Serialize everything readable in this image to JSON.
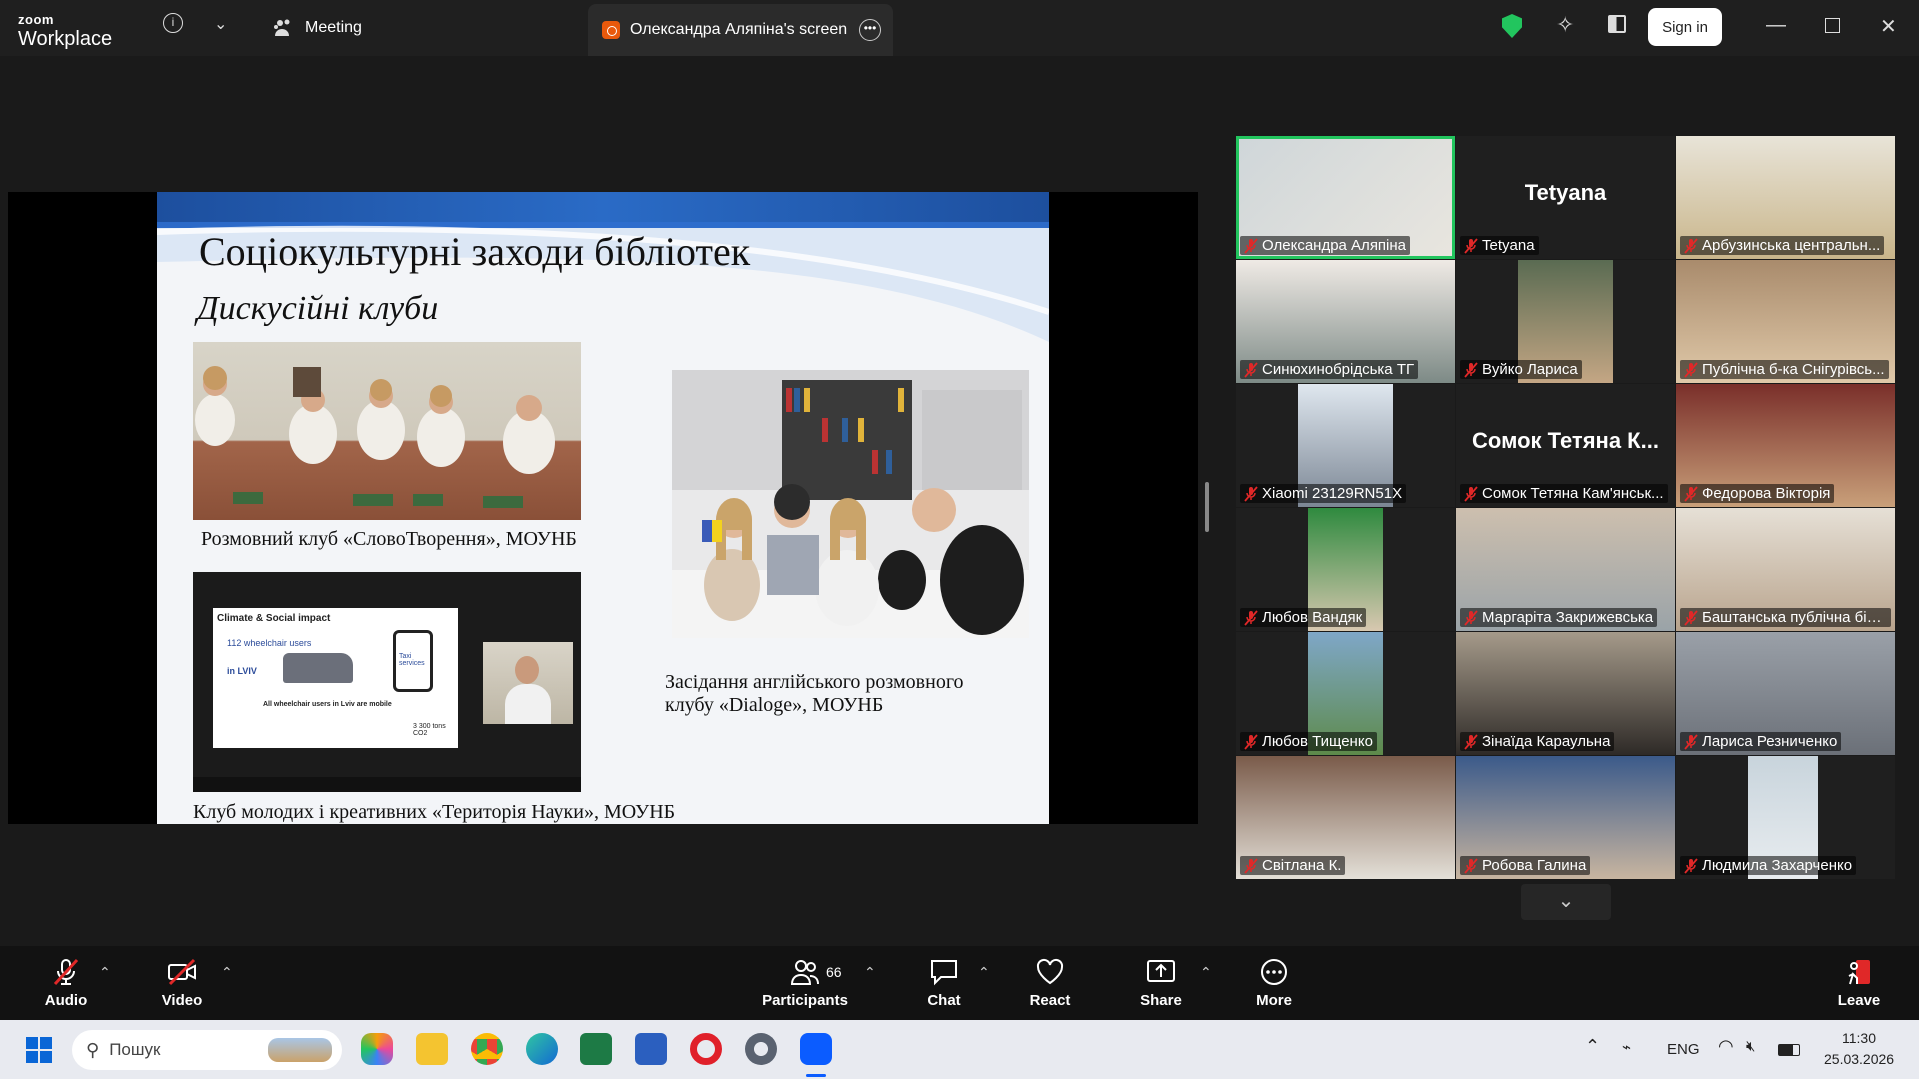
{
  "topbar": {
    "logo_small": "zoom",
    "logo_big": "Workplace",
    "meeting_label": "Meeting",
    "share_tab_label": "Олександра Аляпіна's screen",
    "signin_label": "Sign in"
  },
  "slide": {
    "title": "Соціокультурні заходи бібліотек",
    "subtitle": "Дискусійні клуби",
    "caption1": "Розмовний клуб «СловоТворення», МОУНБ",
    "caption2_line1": "Засідання англійського розмовного",
    "caption2_line2": "клубу «Dialoge», МОУНБ",
    "caption3": "Клуб молодих і креативних «Територія Науки», МОУНБ",
    "inner_slide_title": "Climate & Social impact",
    "inner_text1": "112 wheelchair users",
    "inner_text2": "in LVIV",
    "inner_text3": "All wheelchair users in Lviv are mobile",
    "inner_text4": "Taxi services",
    "inner_text5": "3 300 tons CO2"
  },
  "participants": [
    {
      "name": "Олександра Аляпіна",
      "big": ""
    },
    {
      "name": "Tetyana",
      "big": "Tetyana"
    },
    {
      "name": "Арбузинська центральн...",
      "big": ""
    },
    {
      "name": "Синюхинобрідська ТГ",
      "big": ""
    },
    {
      "name": "Вуйко Лариса",
      "big": ""
    },
    {
      "name": "Публічна б-ка Снігурівсь...",
      "big": ""
    },
    {
      "name": "Xiaomi 23129RN51X",
      "big": ""
    },
    {
      "name": "Сомок Тетяна Кам'янськ...",
      "big": "Сомок Тетяна К..."
    },
    {
      "name": "Федорова Вікторія",
      "big": ""
    },
    {
      "name": "Любов Вандяк",
      "big": ""
    },
    {
      "name": "Маргаріта Закрижевська",
      "big": ""
    },
    {
      "name": "Баштанська публічна біб...",
      "big": ""
    },
    {
      "name": "Любов Тищенко",
      "big": ""
    },
    {
      "name": "Зінаїда Караульна",
      "big": ""
    },
    {
      "name": "Лариса Резниченко",
      "big": ""
    },
    {
      "name": "Світлана К.",
      "big": ""
    },
    {
      "name": "Робова Галина",
      "big": ""
    },
    {
      "name": "Людмила Захарченко",
      "big": ""
    }
  ],
  "toolbar": {
    "audio": "Audio",
    "video": "Video",
    "participants": "Participants",
    "participants_count": "66",
    "chat": "Chat",
    "react": "React",
    "share": "Share",
    "more": "More",
    "leave": "Leave"
  },
  "taskbar": {
    "search_placeholder": "Пошук",
    "lang": "ENG",
    "time": "11:30",
    "date": "25.03.2026"
  },
  "colors": {
    "accent_green": "#22c55e",
    "zoom_blue": "#0b5cff",
    "mute_red": "#e02828"
  }
}
